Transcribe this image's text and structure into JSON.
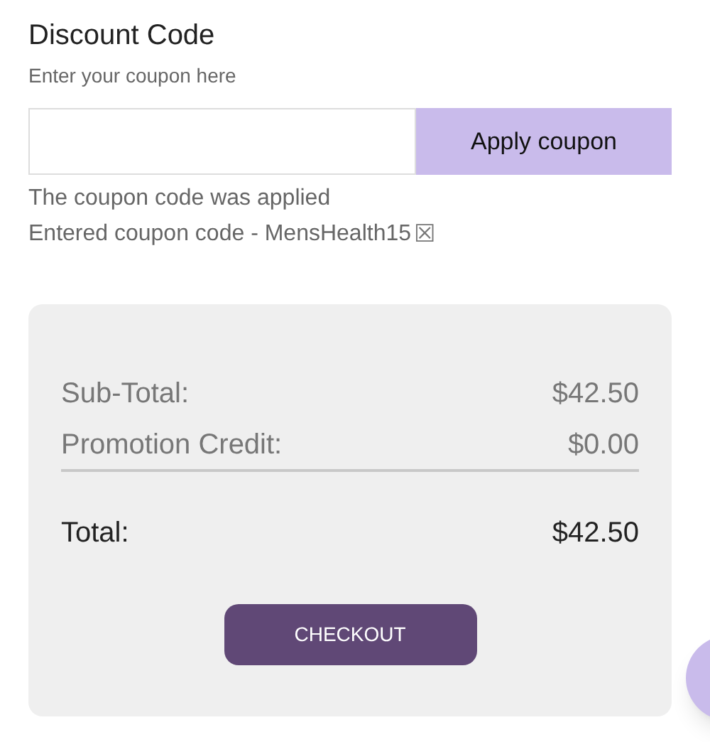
{
  "discount": {
    "title": "Discount Code",
    "subtitle": "Enter your coupon here",
    "apply_button": "Apply coupon",
    "messages": [
      {
        "text": "The coupon code was applied"
      },
      {
        "text": "Entered coupon code - MensHealth15",
        "remove_icon": "☒"
      }
    ]
  },
  "summary": {
    "rows": [
      {
        "label": "Sub-Total:",
        "value": "$42.50",
        "kind": "line"
      },
      {
        "label": "Promotion Credit:",
        "value": "$0.00",
        "kind": "line"
      },
      {
        "label": "Total:",
        "value": "$42.50",
        "kind": "total"
      }
    ],
    "checkout_button": "CHECKOUT"
  }
}
